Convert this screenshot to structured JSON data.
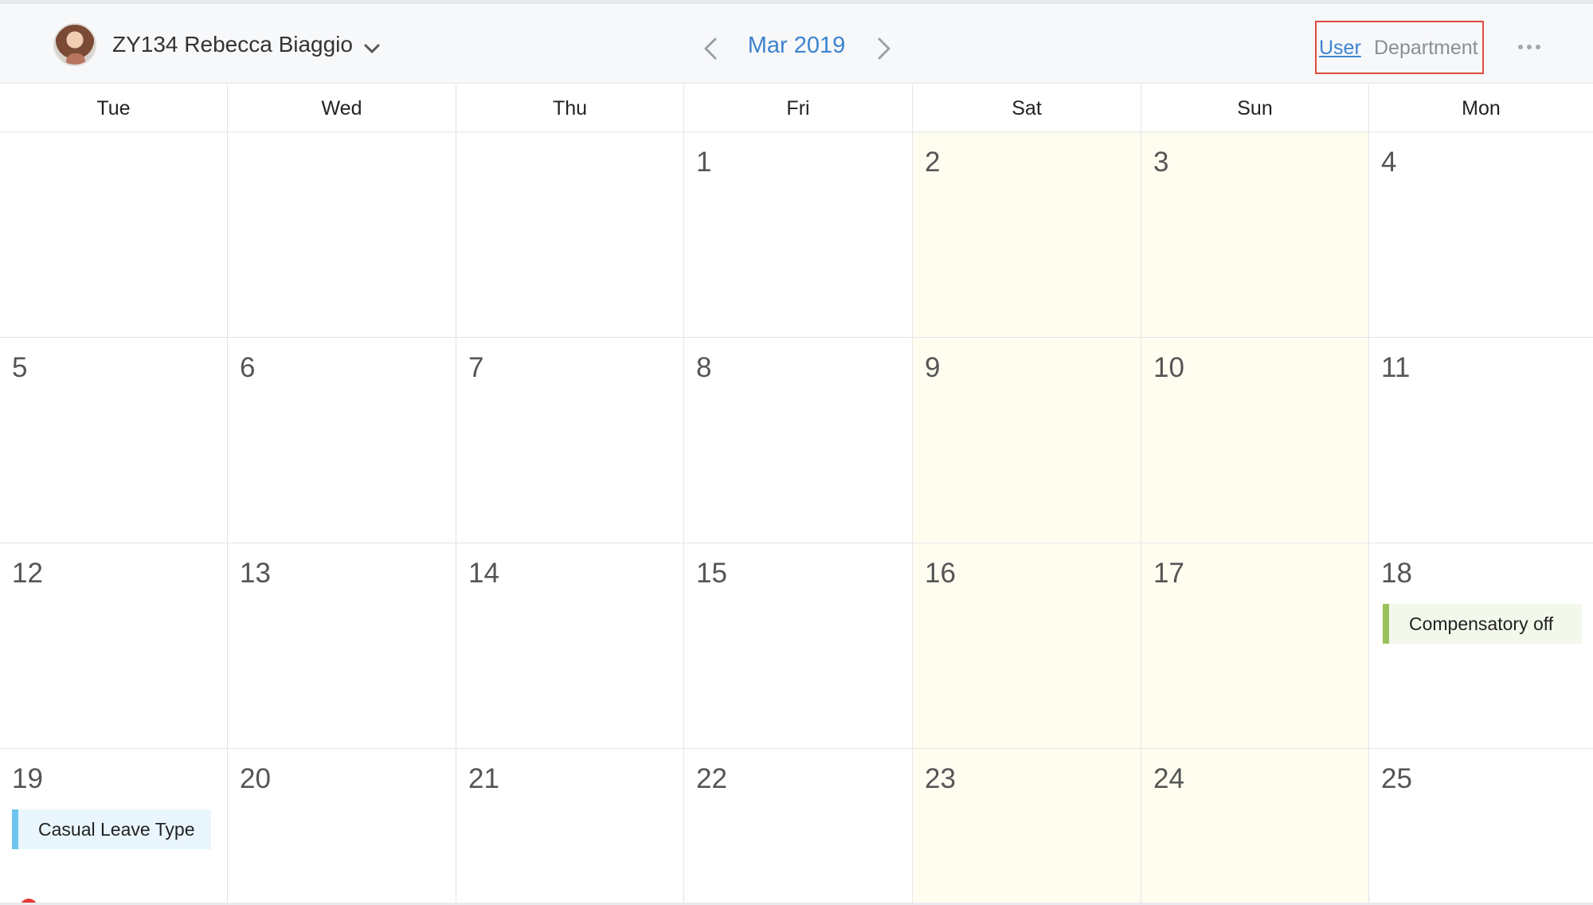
{
  "header": {
    "user_name": "ZY134 Rebecca Biaggio",
    "month": "Mar 2019",
    "view_user": "User",
    "view_department": "Department"
  },
  "weekdays": [
    "Tue",
    "Wed",
    "Thu",
    "Fri",
    "Sat",
    "Sun",
    "Mon"
  ],
  "weeks": [
    [
      "",
      "",
      "",
      "1",
      "2",
      "3",
      "4"
    ],
    [
      "5",
      "6",
      "7",
      "8",
      "9",
      "10",
      "11"
    ],
    [
      "12",
      "13",
      "14",
      "15",
      "16",
      "17",
      "18"
    ],
    [
      "19",
      "20",
      "21",
      "22",
      "23",
      "24",
      "25"
    ]
  ],
  "events": {
    "compensatory": "Compensatory off",
    "casual": "Casual Leave Type"
  },
  "colors": {
    "accent": "#3d84d0",
    "weekend": "#fffdf0",
    "comp_bar": "#9bc15b",
    "casual_bar": "#6cc6ef",
    "highlight_border": "#e04b3c"
  },
  "icons": {
    "avatar": "user-avatar",
    "user_dropdown": "chevron-down-icon",
    "prev": "chevron-left-icon",
    "next": "chevron-right-icon",
    "more": "more-horizontal-icon"
  }
}
